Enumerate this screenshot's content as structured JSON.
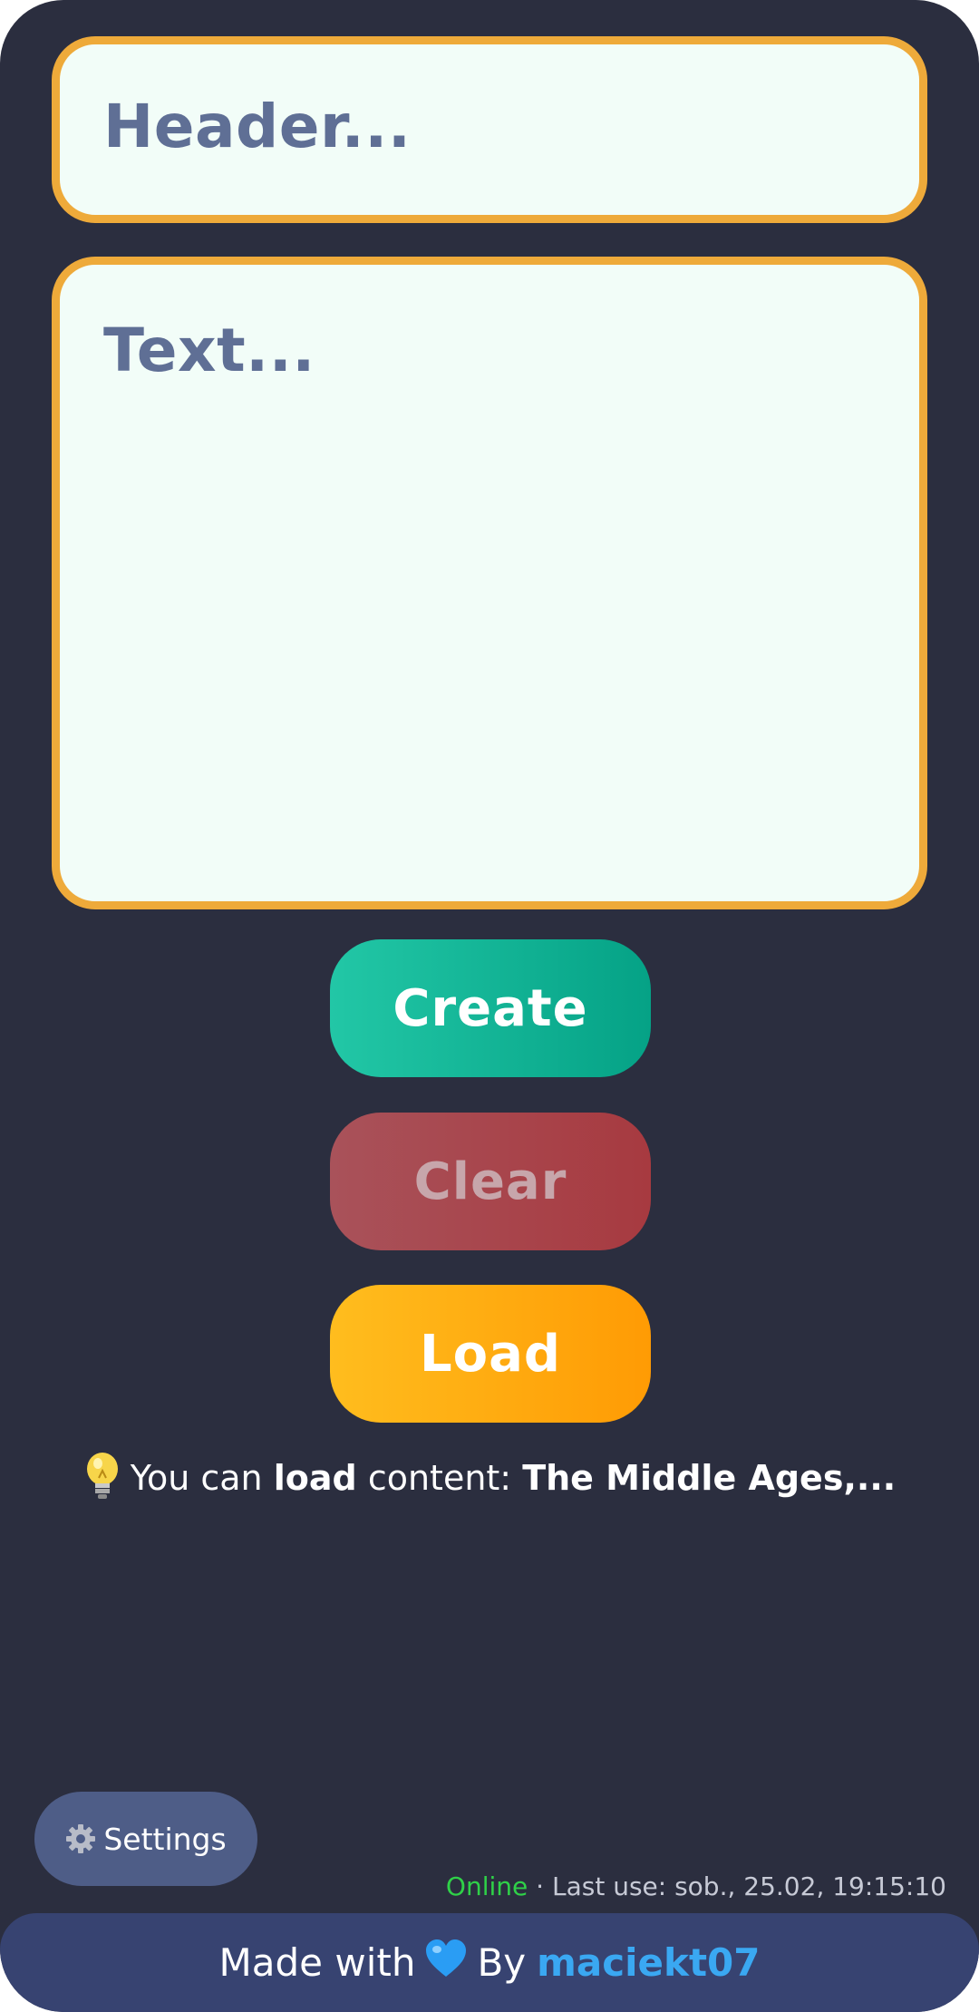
{
  "header_field": {
    "placeholder": "Header..."
  },
  "text_field": {
    "placeholder": "Text..."
  },
  "buttons": {
    "create": "Create",
    "clear": "Clear",
    "load": "Load"
  },
  "tip": {
    "icon": "lightbulb-icon",
    "prefix": "You can",
    "bold_word": "load",
    "middle": "content:",
    "topic": "The Middle Ages,..."
  },
  "settings": {
    "icon": "gear-icon",
    "label": "Settings"
  },
  "status": {
    "state": "Online",
    "separator": "·",
    "last_use": "Last use: sob., 25.02, 19:15:10"
  },
  "footer": {
    "made_with": "Made with",
    "heart_icon": "blue-heart-icon",
    "by": "By",
    "author": "maciekt07"
  },
  "colors": {
    "background": "#2b2e3f",
    "field_border": "#eeaa3a",
    "field_bg": "#f2fdf8",
    "create": "#10b394",
    "clear": "#a8464d",
    "load": "#ffab12",
    "settings_bg": "#4e5d87",
    "footer_bg": "#374371",
    "online": "#2fd148",
    "author_link": "#3aa8f2"
  }
}
